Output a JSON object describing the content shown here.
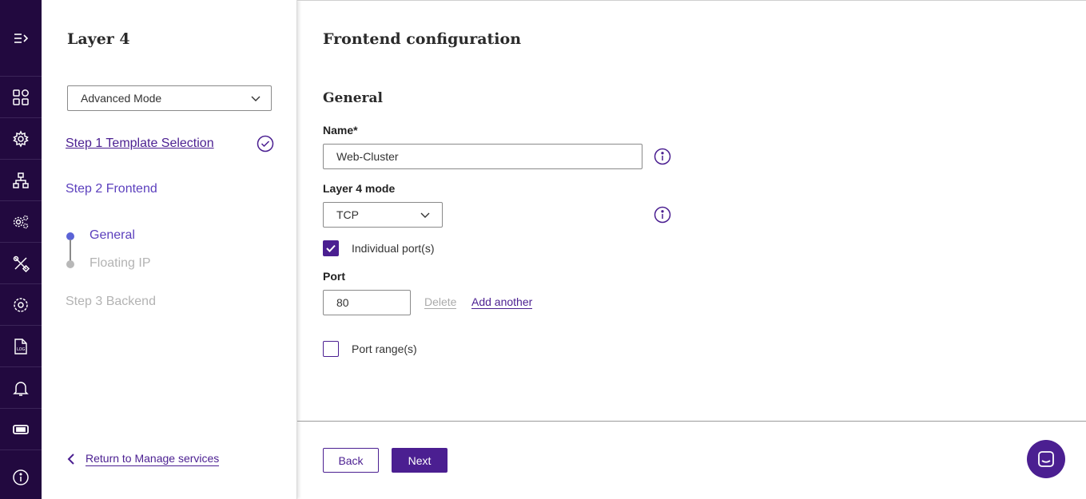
{
  "rail": {
    "items": [
      {
        "icon": "expand-menu-icon"
      },
      {
        "icon": "dashboard-grid-icon"
      },
      {
        "icon": "services-gear-icon"
      },
      {
        "icon": "network-icon"
      },
      {
        "icon": "settings-cogs-icon"
      },
      {
        "icon": "tools-icon"
      },
      {
        "icon": "settings-icon"
      },
      {
        "icon": "log-file-icon"
      },
      {
        "icon": "bell-icon"
      },
      {
        "icon": "ticket-icon"
      },
      {
        "icon": "info-icon"
      }
    ]
  },
  "wizard": {
    "title": "Layer 4",
    "mode_select": "Advanced Mode",
    "steps": {
      "step1": "Step 1 Template Selection",
      "step2": "Step 2 Frontend",
      "step3": "Step 3 Backend"
    },
    "substeps": {
      "general": "General",
      "floating_ip": "Floating IP"
    },
    "return_link": "Return to Manage services"
  },
  "main": {
    "title": "Frontend configuration",
    "section_title": "General",
    "name_label": "Name*",
    "name_value": "Web-Cluster",
    "mode_label": "Layer 4 mode",
    "mode_value": "TCP",
    "individual_ports_label": "Individual port(s)",
    "individual_ports_checked": true,
    "port_label": "Port",
    "port_value": "80",
    "delete_link": "Delete",
    "add_another_link": "Add another",
    "port_ranges_label": "Port range(s)",
    "port_ranges_checked": false,
    "back_button": "Back",
    "next_button": "Next"
  },
  "colors": {
    "rail_bg": "#22093f",
    "accent": "#4b1f91",
    "active_step": "#5b3fbd",
    "disabled": "#b3b3b3"
  }
}
